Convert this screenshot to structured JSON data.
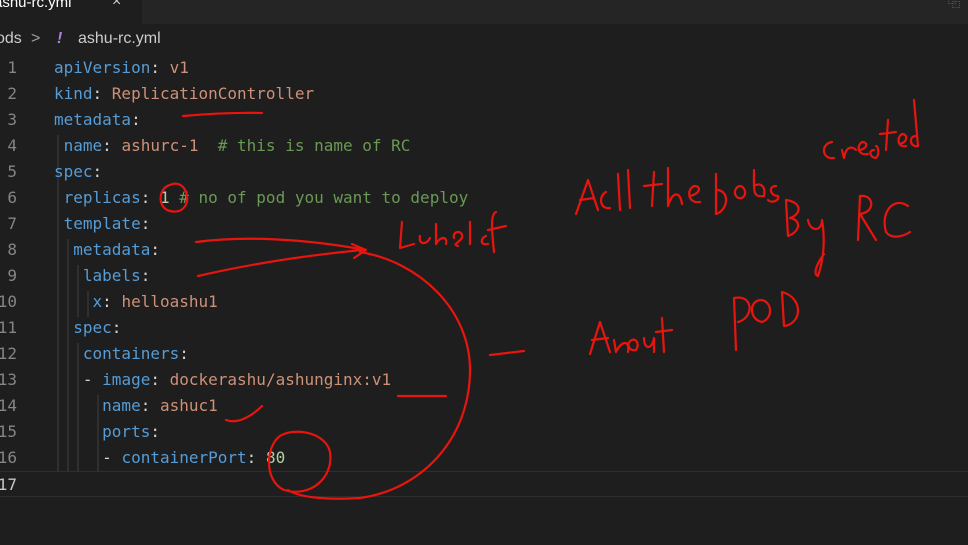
{
  "tab": {
    "filename": "ashu-rc.yml",
    "close_glyph": "×",
    "split_glyph": "⿻"
  },
  "breadcrumb": {
    "folder": "ods",
    "separator": ">",
    "file_icon": "!",
    "file": "ashu-rc.yml"
  },
  "lines": [
    {
      "num": "1",
      "tokens": [
        {
          "t": "apiVersion",
          "c": "k"
        },
        {
          "t": ": ",
          "c": "p"
        },
        {
          "t": "v1",
          "c": "s"
        }
      ]
    },
    {
      "num": "2",
      "tokens": [
        {
          "t": "kind",
          "c": "k"
        },
        {
          "t": ": ",
          "c": "p"
        },
        {
          "t": "ReplicationController",
          "c": "s"
        }
      ]
    },
    {
      "num": "3",
      "tokens": [
        {
          "t": "metadata",
          "c": "k"
        },
        {
          "t": ":",
          "c": "p"
        }
      ]
    },
    {
      "num": "4",
      "tokens": [
        {
          "t": " name",
          "c": "k"
        },
        {
          "t": ": ",
          "c": "p"
        },
        {
          "t": "ashurc-1  ",
          "c": "s"
        },
        {
          "t": "# this is name of RC",
          "c": "c"
        }
      ]
    },
    {
      "num": "5",
      "tokens": [
        {
          "t": "spec",
          "c": "k"
        },
        {
          "t": ":",
          "c": "p"
        }
      ]
    },
    {
      "num": "6",
      "tokens": [
        {
          "t": " replicas",
          "c": "k"
        },
        {
          "t": ": ",
          "c": "p"
        },
        {
          "t": "1 ",
          "c": "n"
        },
        {
          "t": "# no of pod you want to deploy",
          "c": "c"
        }
      ]
    },
    {
      "num": "7",
      "tokens": [
        {
          "t": " template",
          "c": "k"
        },
        {
          "t": ":",
          "c": "p"
        }
      ]
    },
    {
      "num": "8",
      "tokens": [
        {
          "t": "  metadata",
          "c": "k"
        },
        {
          "t": ":",
          "c": "p"
        }
      ]
    },
    {
      "num": "9",
      "tokens": [
        {
          "t": "   labels",
          "c": "k"
        },
        {
          "t": ":",
          "c": "p"
        }
      ]
    },
    {
      "num": "10",
      "tokens": [
        {
          "t": "    x",
          "c": "k"
        },
        {
          "t": ": ",
          "c": "p"
        },
        {
          "t": "helloashu1",
          "c": "s"
        }
      ]
    },
    {
      "num": "11",
      "tokens": [
        {
          "t": "  spec",
          "c": "k"
        },
        {
          "t": ":",
          "c": "p"
        }
      ]
    },
    {
      "num": "12",
      "tokens": [
        {
          "t": "   containers",
          "c": "k"
        },
        {
          "t": ":",
          "c": "p"
        }
      ]
    },
    {
      "num": "13",
      "tokens": [
        {
          "t": "   - ",
          "c": "p"
        },
        {
          "t": "image",
          "c": "k"
        },
        {
          "t": ": ",
          "c": "p"
        },
        {
          "t": "dockerashu/ashunginx:v1",
          "c": "s"
        }
      ]
    },
    {
      "num": "14",
      "tokens": [
        {
          "t": "     name",
          "c": "k"
        },
        {
          "t": ": ",
          "c": "p"
        },
        {
          "t": "ashuc1",
          "c": "s"
        }
      ]
    },
    {
      "num": "15",
      "tokens": [
        {
          "t": "     ports",
          "c": "k"
        },
        {
          "t": ":",
          "c": "p"
        }
      ]
    },
    {
      "num": "16",
      "tokens": [
        {
          "t": "     - ",
          "c": "p"
        },
        {
          "t": "containerPort",
          "c": "k"
        },
        {
          "t": ": ",
          "c": "p"
        },
        {
          "t": "80",
          "c": "n"
        }
      ]
    },
    {
      "num": "17",
      "tokens": []
    }
  ],
  "colors": {
    "k": "#569cd6",
    "p": "#d4d4d4",
    "s": "#ce9178",
    "c": "#6a9955",
    "n": "#b5cea8",
    "annotation": "#e8150f"
  }
}
